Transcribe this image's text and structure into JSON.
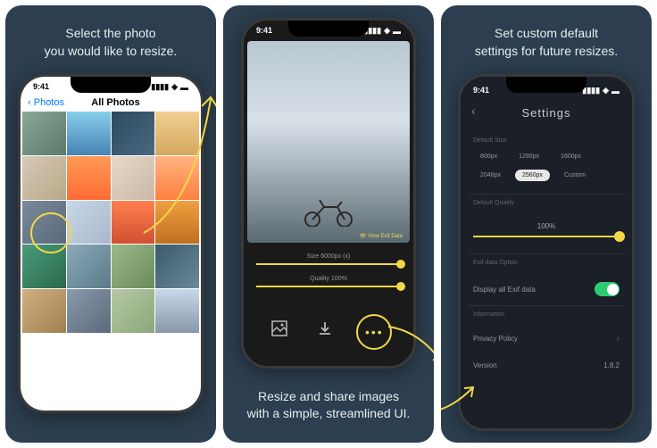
{
  "panel1": {
    "caption": "Select the photo\nyou would like to resize.",
    "status_time": "9:41",
    "nav_back": "Photos",
    "nav_title": "All Photos"
  },
  "panel2": {
    "caption": "Resize and share images\nwith a simple, streamlined UI.",
    "status_time": "9:41",
    "exif_link": "View Exif Data",
    "size_label": "Size 6000px (x)",
    "quality_label": "Quality 100%"
  },
  "panel3": {
    "caption": "Set custom default\nsettings for future resizes.",
    "status_time": "9:41",
    "title": "Settings",
    "section_size": "Default Size",
    "sizes": [
      "800px",
      "1280px",
      "1600px",
      "2048px",
      "2560px",
      "Custom"
    ],
    "selected_size_index": 4,
    "section_quality": "Default Quality",
    "quality_value": "100%",
    "section_exif": "Exif data Option",
    "exif_row": "Display all Exif data",
    "section_info": "Information",
    "privacy_row": "Privacy Policy",
    "version_label": "Version",
    "version_value": "1.8.2"
  }
}
